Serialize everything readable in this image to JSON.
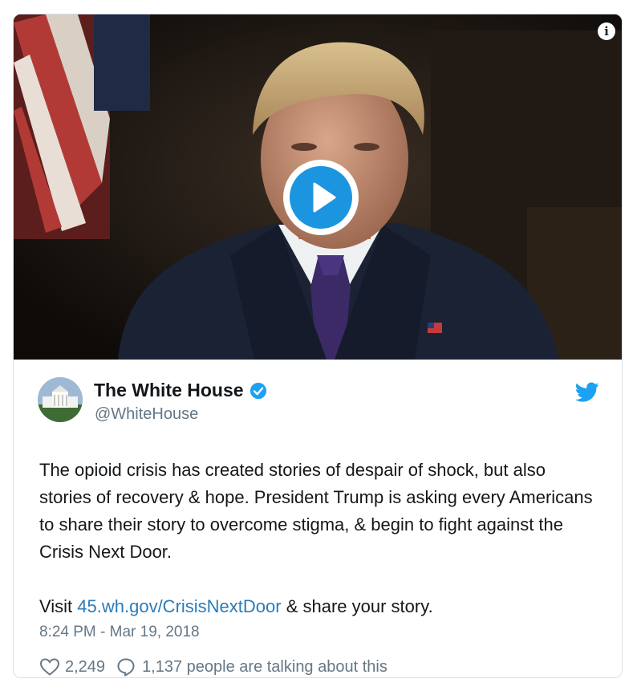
{
  "media": {
    "info_icon": "info-icon",
    "play_icon": "play-icon",
    "colors": {
      "play_blue": "#1c95e0"
    }
  },
  "author": {
    "name": "The White House",
    "handle": "@WhiteHouse",
    "verified_icon": "verified-badge-icon",
    "brand_icon": "twitter-bird-icon"
  },
  "tweet": {
    "text_part1": "The opioid crisis has created stories of despair of shock, but also stories of recovery & hope. President Trump is asking every Americans to share their story to overcome stigma, & begin to fight against the Crisis Next Door.",
    "visit_prefix": "Visit ",
    "link_text": "45.wh.gov/CrisisNextDoor",
    "visit_suffix": " & share your story.",
    "timestamp": "8:24 PM - Mar 19, 2018"
  },
  "actions": {
    "likes": "2,249",
    "talking": "1,137 people are talking about this"
  },
  "colors": {
    "link": "#2b7bb9",
    "secondary_text": "#657786",
    "twitter_blue": "#1da1f2"
  }
}
